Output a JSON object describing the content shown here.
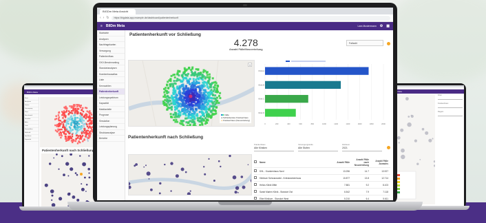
{
  "colors": {
    "brand_purple": "#4a2b85",
    "bar_blue": "#2455c9",
    "bar_teal": "#197a8f",
    "bar_green": "#3aa84a",
    "bar_lime": "#3fd14d",
    "accent_orange": "#f5a623"
  },
  "main": {
    "browser": {
      "tab_label": "BIGDm Meta Ansicht",
      "url": "https://bigdata-app.example.de/dashboard/patientenherkunft"
    },
    "app": {
      "name": "BIIDm Meta",
      "user": "Lars Mustermann"
    },
    "sidebar": [
      "Startseite",
      "Analysen",
      "Nachfragekarten",
      "Versorgung",
      "Patientenfluss",
      "GKV-Benchmarking",
      "Standortanalysen",
      "Krankenhausatlas",
      "Liste",
      "Kennzahlen",
      "Patientenherkunft",
      "Leistungsspektrum",
      "Kapazität",
      "Marktanteile",
      "Prognose",
      "Simulation",
      "Leistungsplanung",
      "Strukturanalyse",
      "Berichte"
    ],
    "sidebar_active_index": 10,
    "section1": {
      "title": "Patientenherkunft vor Schließung",
      "kpi_value": "4.278",
      "kpi_label": "Anzahl Fälle/Neuverteilung",
      "select_value": "Fallzahl",
      "map_legend": [
        "Fälle",
        "Schließendes Krankenhaus",
        "Krankenhaus (Neuverteilung)"
      ]
    },
    "chart_data": {
      "type": "bar",
      "orientation": "horizontal",
      "categories": [
        "Klinik A",
        "Klinik B",
        "Klinik C",
        "Klinik D"
      ],
      "values": [
        1750,
        1280,
        730,
        520
      ],
      "colors": [
        "#2455c9",
        "#197a8f",
        "#3aa84a",
        "#3fd14d"
      ],
      "xlim": [
        0,
        2000
      ],
      "xticks": [
        0,
        200,
        400,
        600,
        800,
        1000,
        1200,
        1400,
        1600,
        1800,
        2000
      ],
      "grid": true,
      "legend": "top"
    },
    "section2": {
      "title": "Patientenherkunft nach Schließung",
      "filters": [
        {
          "label": "Krankenhaus",
          "value": "Alle Kliniken"
        },
        {
          "label": "Versorgungsstufe",
          "value": "Alle Stufen"
        },
        {
          "label": "Zeitraum",
          "value": "2021"
        }
      ],
      "table": {
        "headers": [
          "Name",
          "Anzahl Fälle",
          "Anzahl Fälle nach Neuverteilung",
          "Anzahl Fälle Zuwachs"
        ],
        "rows": [
          {
            "name": "KHL - Krankenhaus Nord",
            "a": "13.256",
            "b": "14.7",
            "c": "13.927"
          },
          {
            "name": "Klinikum Schwarzwald - Kreiskrankenhaus",
            "a": "10.877",
            "b": "13.8",
            "c": "12.714"
          },
          {
            "name": "Helios Klinik Mitte",
            "a": "7.881",
            "b": "9.2",
            "c": "8.103"
          },
          {
            "name": "Sankt Marien Klinik - Standort Ost",
            "a": "6.542",
            "b": "7.9",
            "c": "7.118"
          },
          {
            "name": "Elbe Klinikum - Standort West",
            "a": "5.210",
            "b": "6.4",
            "c": "5.611"
          }
        ]
      }
    }
  },
  "left": {
    "app_name": "BIIDm Meta",
    "title": "Patientenherkunft nach Schließung",
    "sidebar": [
      "Start",
      "Analysen",
      "Karten",
      "Versorgung",
      "Fluss",
      "Benchmark",
      "Standort",
      "Atlas",
      "Liste",
      "Kennzahlen",
      "Herkunft",
      "Spektrum",
      "Kapazität"
    ]
  },
  "right": {
    "app_name": "BIIDm Meta",
    "field_labels": [
      "Filter",
      "Krankenhaus",
      "Region"
    ]
  }
}
